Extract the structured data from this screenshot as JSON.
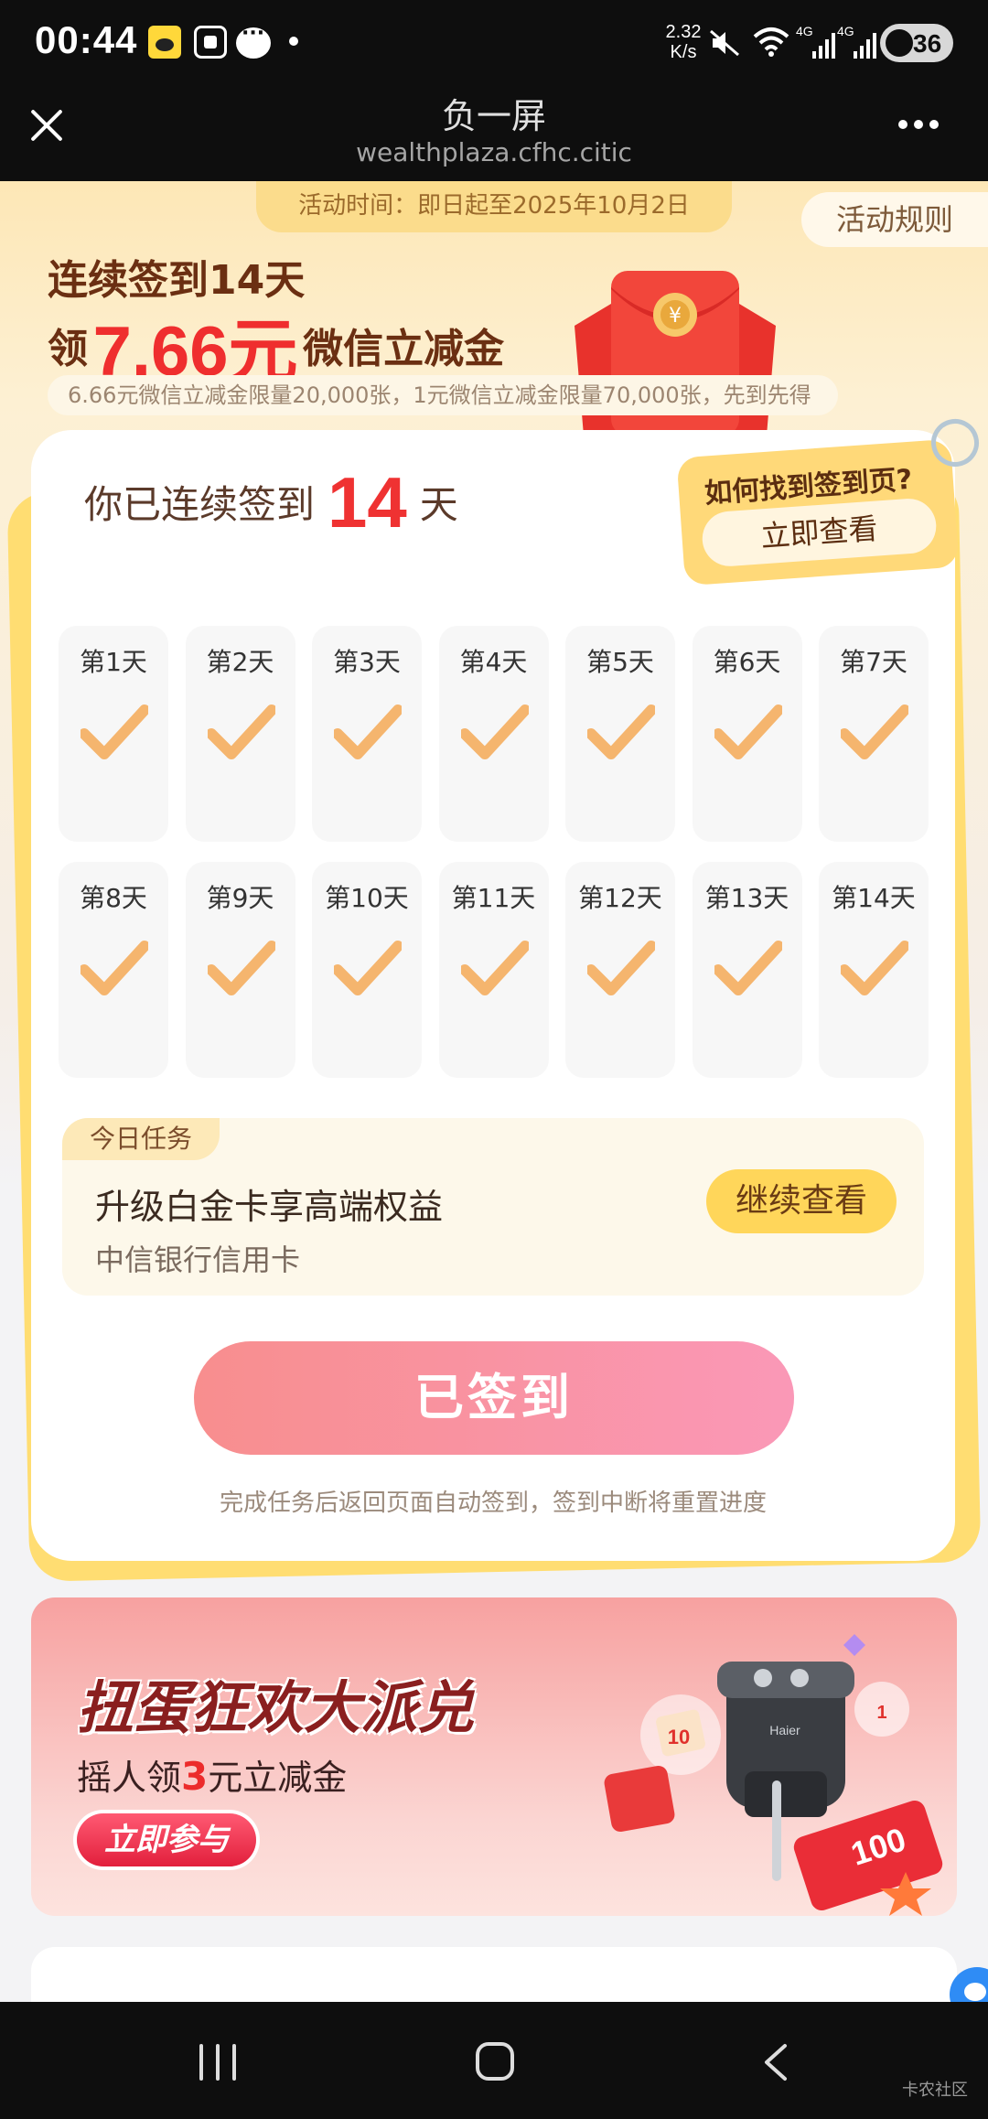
{
  "status_bar": {
    "time": "00:44",
    "net_speed_value": "2.32",
    "net_speed_unit": "K/s",
    "signal1_label": "4G",
    "signal2_label": "4G",
    "battery": "36"
  },
  "title_bar": {
    "title": "负一屏",
    "subtitle": "wealthplaza.cfhc.citic"
  },
  "hero": {
    "activity_period": "活动时间：即日起至2025年10月2日",
    "rules_label": "活动规则",
    "line1": "连续签到14天",
    "line2_prefix": "领",
    "line2_amount": "7.66元",
    "line2_suffix": "微信立减金",
    "limit_note": "6.66元微信立减金限量20,000张，1元微信立减金限量70,000张，先到先得"
  },
  "sign_card": {
    "streak_prefix": "你已连续签到",
    "streak_days": "14",
    "streak_suffix": "天",
    "find_title": "如何找到签到页?",
    "find_button": "立即查看",
    "days": [
      {
        "label": "第1天",
        "checked": true
      },
      {
        "label": "第2天",
        "checked": true
      },
      {
        "label": "第3天",
        "checked": true
      },
      {
        "label": "第4天",
        "checked": true
      },
      {
        "label": "第5天",
        "checked": true
      },
      {
        "label": "第6天",
        "checked": true
      },
      {
        "label": "第7天",
        "checked": true
      },
      {
        "label": "第8天",
        "checked": true
      },
      {
        "label": "第9天",
        "checked": true
      },
      {
        "label": "第10天",
        "checked": true
      },
      {
        "label": "第11天",
        "checked": true
      },
      {
        "label": "第12天",
        "checked": true
      },
      {
        "label": "第13天",
        "checked": true
      },
      {
        "label": "第14天",
        "checked": true
      }
    ],
    "task": {
      "tag": "今日任务",
      "title": "升级白金卡享高端权益",
      "subtitle": "中信银行信用卡",
      "button": "继续查看"
    },
    "signed_button": "已签到",
    "signed_note": "完成任务后返回页面自动签到，签到中断将重置进度"
  },
  "banner": {
    "title": "扭蛋狂欢大派兑",
    "sub_prefix": "摇人领",
    "sub_highlight": "3",
    "sub_suffix": "元立减金",
    "button": "立即参与",
    "coupon_amount": "100",
    "coupon_small_1": "10",
    "coupon_small_2": "1",
    "brand": "Haier"
  },
  "nav_bar": {
    "watermark": "卡农社区"
  },
  "colors": {
    "accent_red": "#ef3232",
    "check_orange": "#f5b56e",
    "pill_yellow": "#ffd65a",
    "signed_pink": "#f88e8e"
  },
  "icons": [
    "close-icon",
    "more-icon",
    "checkmark-icon",
    "red-envelope-icon",
    "paperclip-icon",
    "chat-bubble-icon",
    "recent-apps-icon",
    "home-icon",
    "back-icon",
    "wifi-icon",
    "mute-icon",
    "signal-icon",
    "battery-icon"
  ]
}
